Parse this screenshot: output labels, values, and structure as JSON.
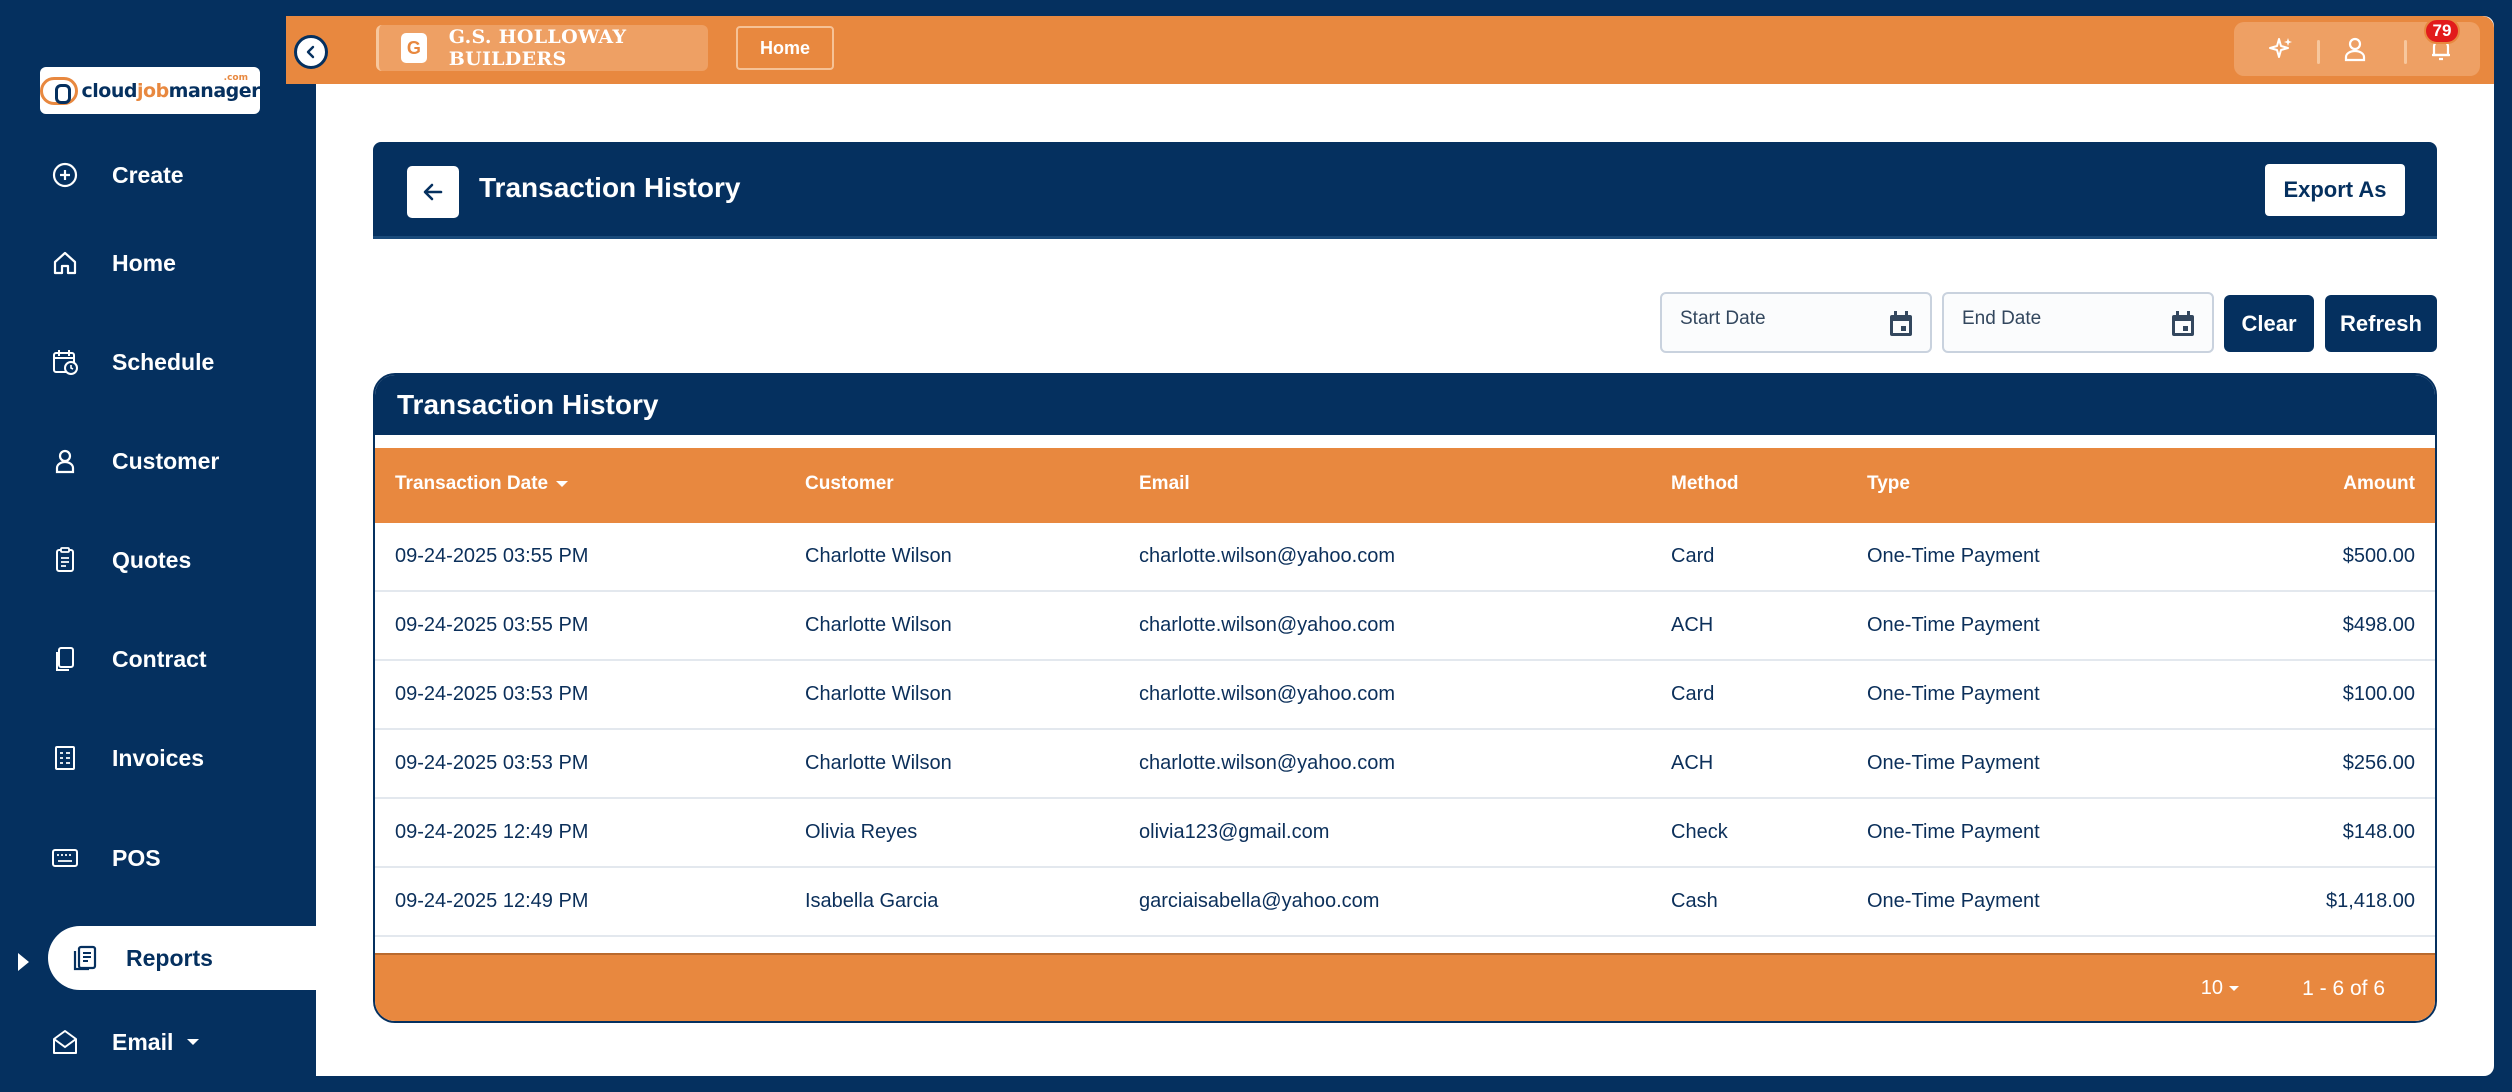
{
  "brand": {
    "logo_text_a": "cloud",
    "logo_text_b": "job",
    "logo_text_c": "manager",
    "logo_suffix": ".com"
  },
  "sidebar": {
    "items": [
      {
        "label": "Create",
        "icon": "plus-circle-icon"
      },
      {
        "label": "Home",
        "icon": "home-icon"
      },
      {
        "label": "Schedule",
        "icon": "calendar-clock-icon"
      },
      {
        "label": "Customer",
        "icon": "user-icon"
      },
      {
        "label": "Quotes",
        "icon": "clipboard-icon"
      },
      {
        "label": "Contract",
        "icon": "document-icon"
      },
      {
        "label": "Invoices",
        "icon": "invoice-icon"
      },
      {
        "label": "POS",
        "icon": "keyboard-icon"
      },
      {
        "label": "Reports",
        "icon": "reports-icon",
        "active": true
      },
      {
        "label": "Email",
        "icon": "mail-icon"
      }
    ]
  },
  "topbar": {
    "company_initial": "G",
    "company_name": "G.S. HOLLOWAY BUILDERS",
    "home_label": "Home",
    "notification_count": "79"
  },
  "page": {
    "title": "Transaction History",
    "export_label": "Export As"
  },
  "filters": {
    "start_placeholder": "Start Date",
    "end_placeholder": "End Date",
    "clear_label": "Clear",
    "refresh_label": "Refresh"
  },
  "table": {
    "title": "Transaction History",
    "columns": [
      "Transaction Date",
      "Customer",
      "Email",
      "Method",
      "Type",
      "Amount"
    ],
    "rows": [
      {
        "date": "09-24-2025 03:55 PM",
        "customer": "Charlotte Wilson",
        "email": "charlotte.wilson@yahoo.com",
        "method": "Card",
        "type": "One-Time Payment",
        "amount": "$500.00"
      },
      {
        "date": "09-24-2025 03:55 PM",
        "customer": "Charlotte Wilson",
        "email": "charlotte.wilson@yahoo.com",
        "method": "ACH",
        "type": "One-Time Payment",
        "amount": "$498.00"
      },
      {
        "date": "09-24-2025 03:53 PM",
        "customer": "Charlotte Wilson",
        "email": "charlotte.wilson@yahoo.com",
        "method": "Card",
        "type": "One-Time Payment",
        "amount": "$100.00"
      },
      {
        "date": "09-24-2025 03:53 PM",
        "customer": "Charlotte Wilson",
        "email": "charlotte.wilson@yahoo.com",
        "method": "ACH",
        "type": "One-Time Payment",
        "amount": "$256.00"
      },
      {
        "date": "09-24-2025 12:49 PM",
        "customer": "Olivia Reyes",
        "email": "olivia123@gmail.com",
        "method": "Check",
        "type": "One-Time Payment",
        "amount": "$148.00"
      },
      {
        "date": "09-24-2025 12:49 PM",
        "customer": "Isabella Garcia",
        "email": "garciaisabella@yahoo.com",
        "method": "Cash",
        "type": "One-Time Payment",
        "amount": "$1,418.00"
      }
    ],
    "page_size": "10",
    "range": "1 - 6 of 6"
  },
  "colors": {
    "navy": "#05305f",
    "orange": "#e8883f",
    "badge": "#e21b1b"
  }
}
